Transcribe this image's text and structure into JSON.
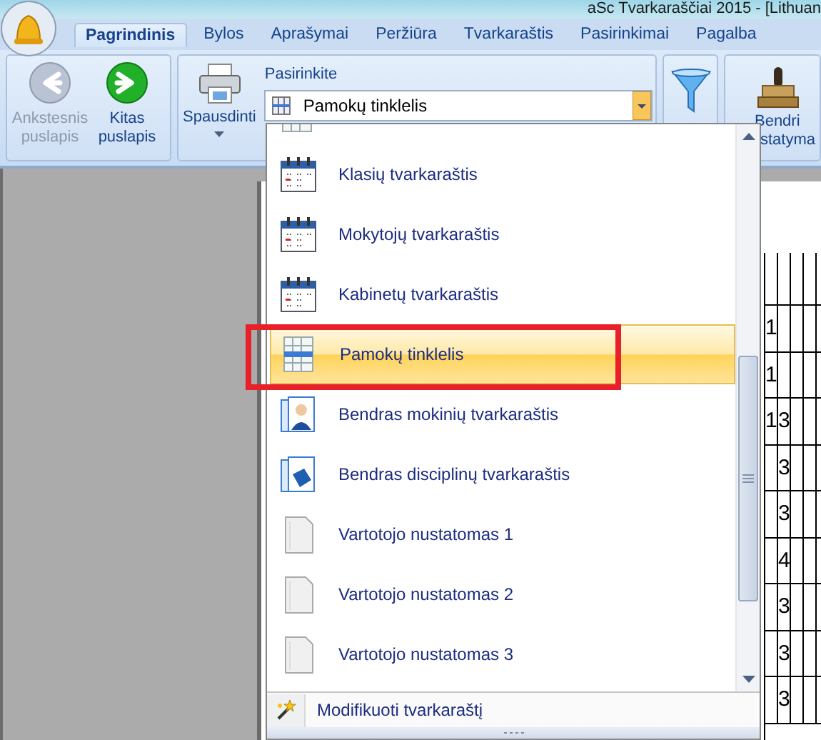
{
  "window": {
    "title": "aSc Tvarkaraščiai 2015 - [Lithuan"
  },
  "tabs": [
    {
      "label": "Pagrindinis",
      "selected": true
    },
    {
      "label": "Bylos",
      "selected": false
    },
    {
      "label": "Aprašymai",
      "selected": false
    },
    {
      "label": "Peržiūra",
      "selected": false
    },
    {
      "label": "Tvarkaraštis",
      "selected": false
    },
    {
      "label": "Pasirinkimai",
      "selected": false
    },
    {
      "label": "Pagalba",
      "selected": false
    }
  ],
  "ribbon": {
    "nav": [
      {
        "label": "Ankstesnis puslapis",
        "kind": "back",
        "disabled": true
      },
      {
        "label": "Kitas puslapis",
        "kind": "forward",
        "disabled": false
      }
    ],
    "print": {
      "label": "Spausdinti"
    },
    "selector": {
      "label": "Pasirinkite",
      "value": "Pamokų tinklelis"
    },
    "settings": {
      "label_lines": [
        "Bendri",
        "statyma"
      ]
    }
  },
  "dropdown": {
    "items": [
      {
        "kind": "grid",
        "partial": true
      },
      {
        "kind": "calendar",
        "label": "Klasių tvarkaraštis",
        "selected": false
      },
      {
        "kind": "calendar",
        "label": "Mokytojų tvarkaraštis",
        "selected": false
      },
      {
        "kind": "calendar",
        "label": "Kabinetų tvarkaraštis",
        "selected": false
      },
      {
        "kind": "grid",
        "label": "Pamokų tinklelis",
        "selected": true
      },
      {
        "kind": "student",
        "label": "Bendras mokinių tvarkaraštis",
        "selected": false
      },
      {
        "kind": "book",
        "label": "Bendras disciplinų tvarkaraštis",
        "selected": false
      },
      {
        "kind": "blank",
        "label": "Vartotojo nustatomas 1",
        "selected": false
      },
      {
        "kind": "blank",
        "label": "Vartotojo nustatomas 2",
        "selected": false
      },
      {
        "kind": "blank",
        "label": "Vartotojo nustatomas 3",
        "selected": false
      }
    ],
    "footer": {
      "label": "Modifikuoti tvarkaraštį"
    }
  },
  "timetable": {
    "rows": [
      {
        "column_1": "1"
      },
      {
        "column_1": "1"
      },
      {
        "column_1": "1",
        "column_2": "3"
      },
      {
        "column_2": "3"
      },
      {
        "column_2": "3"
      },
      {
        "column_2": "4"
      },
      {
        "column_2": "3"
      },
      {
        "column_2": "3"
      },
      {
        "column_2": "3"
      }
    ]
  }
}
